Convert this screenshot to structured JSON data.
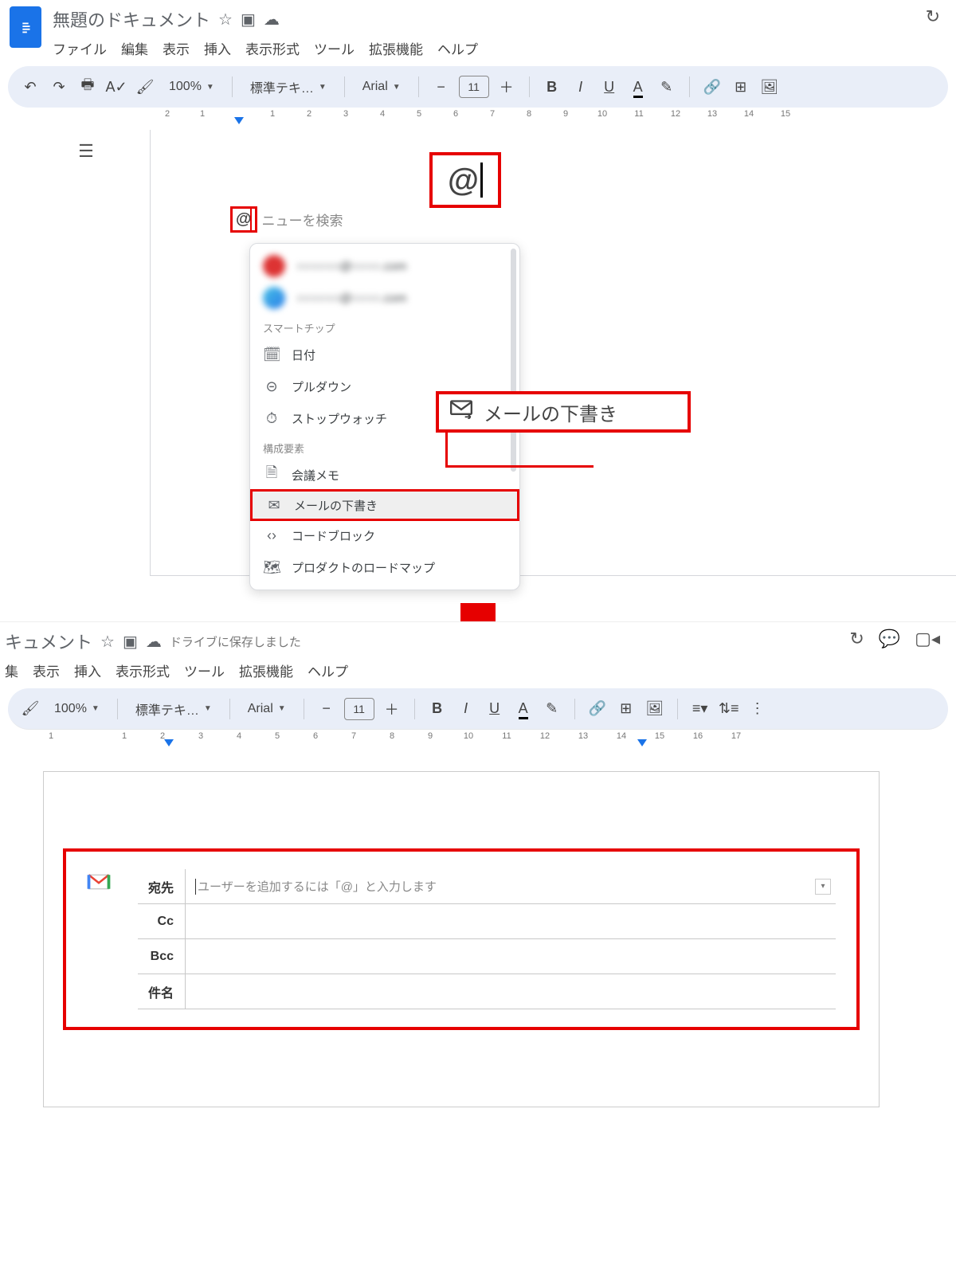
{
  "panel1": {
    "doc_title": "無題のドキュメント",
    "menus": [
      "ファイル",
      "編集",
      "表示",
      "挿入",
      "表示形式",
      "ツール",
      "拡張機能",
      "ヘルプ"
    ],
    "toolbar": {
      "zoom": "100%",
      "style": "標準テキ…",
      "font": "Arial",
      "font_size": "11",
      "minus": "−",
      "plus": "＋"
    },
    "ruler_labels": [
      "2",
      "1",
      "",
      "1",
      "2",
      "3",
      "4",
      "5",
      "6",
      "7",
      "8",
      "9",
      "10",
      "11",
      "12",
      "13",
      "14",
      "15"
    ],
    "at_char": "@",
    "at_placeholder": "ニューを検索",
    "popup": {
      "contact_blur_line1": "○○○○○○@○○○○.com",
      "contact_blur_line2": "○○○○○○@○○○○.com",
      "section_smartchip": "スマートチップ",
      "items_smartchip": [
        {
          "icon": "📅",
          "label": "日付"
        },
        {
          "icon": "⊝",
          "label": "プルダウン"
        },
        {
          "icon": "⏱",
          "label": "ストップウォッチ"
        }
      ],
      "section_building": "構成要素",
      "items_building": [
        {
          "icon": "🗎",
          "label": "会議メモ"
        },
        {
          "icon": "✉",
          "label": "メールの下書き",
          "hl": true
        },
        {
          "icon": "‹ ›",
          "label": "コードブロック"
        },
        {
          "icon": "🗺",
          "label": "プロダクトのロードマップ"
        }
      ]
    },
    "callout_at": "@",
    "callout_email": "メールの下書き"
  },
  "panel2": {
    "doc_title_suffix": "キュメント",
    "saved": "ドライブに保存しました",
    "menus": [
      "集",
      "表示",
      "挿入",
      "表示形式",
      "ツール",
      "拡張機能",
      "ヘルプ"
    ],
    "toolbar": {
      "zoom": "100%",
      "style": "標準テキ…",
      "font": "Arial",
      "font_size": "11"
    },
    "ruler_labels": [
      "1",
      "",
      "1",
      "2",
      "3",
      "4",
      "5",
      "6",
      "7",
      "8",
      "9",
      "10",
      "11",
      "12",
      "13",
      "14",
      "15",
      "16",
      "17",
      "18"
    ],
    "draft": {
      "fields": {
        "to_label": "宛先",
        "to_placeholder": "ユーザーを追加するには「@」と入力します",
        "cc_label": "Cc",
        "bcc_label": "Bcc",
        "subject_label": "件名"
      }
    }
  }
}
